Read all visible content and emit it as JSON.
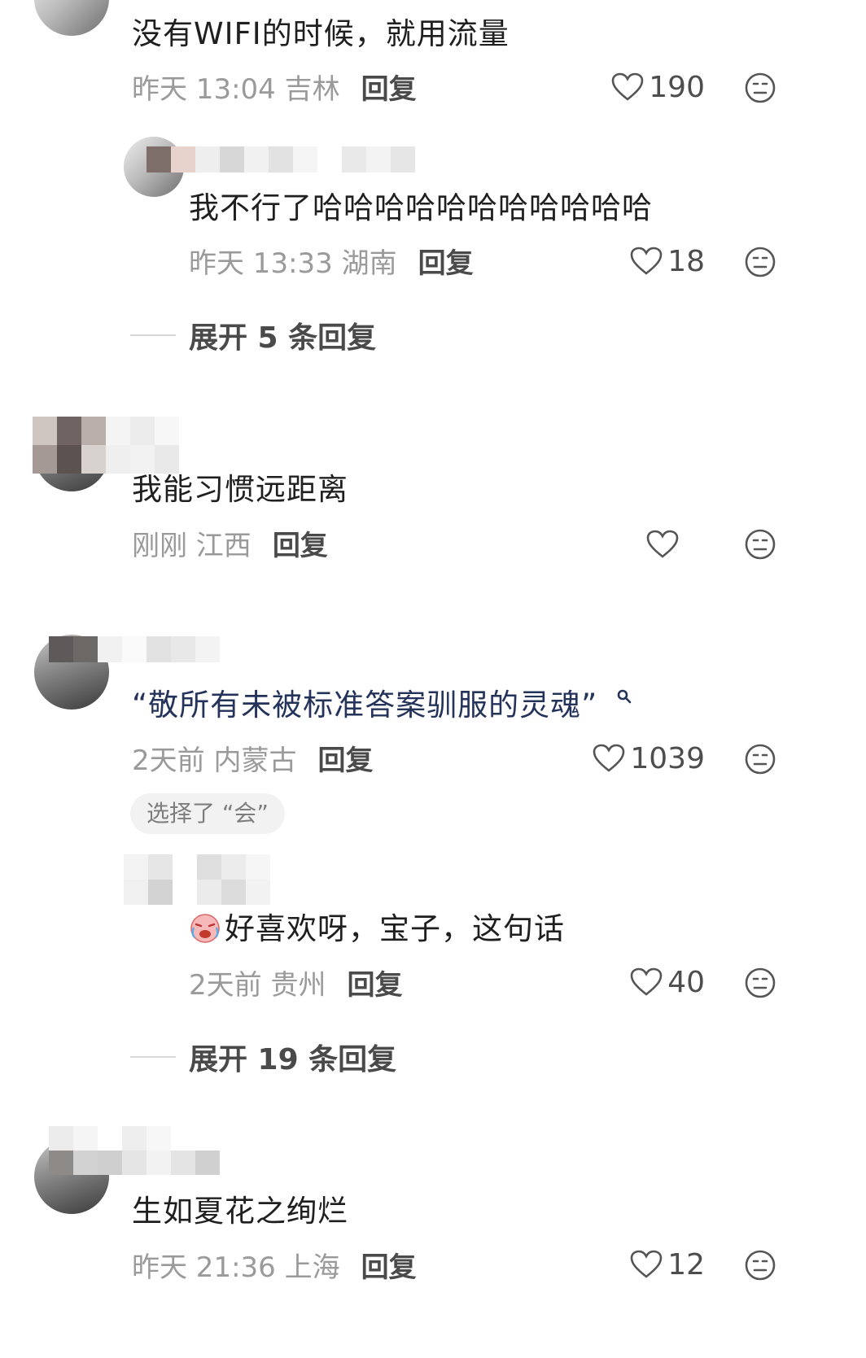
{
  "comments": [
    {
      "text": "没有WIFI的时候，就用流量",
      "time_location": "昨天 13:04 吉林",
      "reply_label": "回复",
      "likes": "190",
      "replies": [
        {
          "text": "我不行了哈哈哈哈哈哈哈哈哈哈哈",
          "time_location": "昨天 13:33 湖南",
          "reply_label": "回复",
          "likes": "18"
        }
      ],
      "expand_label": "展开 5 条回复"
    },
    {
      "text": "我能习惯远距离",
      "time_location": "刚刚 江西",
      "reply_label": "回复",
      "likes": ""
    },
    {
      "text": "“敬所有未被标准答案驯服的灵魂”",
      "time_location": "2天前 内蒙古",
      "reply_label": "回复",
      "likes": "1039",
      "chip": "选择了 “会”",
      "replies": [
        {
          "text": "好喜欢呀，宝子，这句话",
          "time_location": "2天前 贵州",
          "reply_label": "回复",
          "likes": "40"
        }
      ],
      "expand_label": "展开 19 条回复"
    },
    {
      "text": "生如夏花之绚烂",
      "time_location": "昨天 21:36 上海",
      "reply_label": "回复",
      "likes": "12"
    }
  ],
  "icons": {
    "like": "heart-outline-icon",
    "emoji": "face-emoji-icon",
    "search": "search-icon",
    "sticker": "crying-laugh-sticker"
  },
  "colors": {
    "text_primary": "#1f1f1f",
    "text_secondary": "#9a9a9a",
    "reply_label": "#4a4a4a",
    "quote_text": "#24335a"
  }
}
